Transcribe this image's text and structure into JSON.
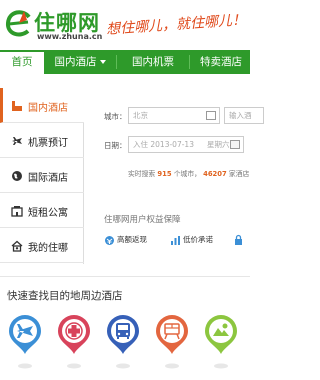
{
  "brand": {
    "logo_name": "住哪网",
    "logo_url": "www.zhuna.cn",
    "slogan": "想住哪儿，就住哪儿！",
    "color": "#2e9a2a"
  },
  "nav": {
    "items": [
      {
        "label": "首页"
      },
      {
        "label": "国内酒店"
      },
      {
        "label": "国内机票"
      },
      {
        "label": "特卖酒店"
      }
    ]
  },
  "sidebar": {
    "items": [
      {
        "label": "国内酒店",
        "icon": "hotel-icon"
      },
      {
        "label": "机票预订",
        "icon": "airplane-icon"
      },
      {
        "label": "国际酒店",
        "icon": "globe-icon"
      },
      {
        "label": "短租公寓",
        "icon": "apartment-icon"
      },
      {
        "label": "我的住哪",
        "icon": "home-icon"
      }
    ]
  },
  "search": {
    "city_label": "城市：",
    "city_value": "北京",
    "keyword_placeholder": "输入酒",
    "date_label": "日期：",
    "checkin_value": "入住  2013-07-13",
    "weekday": "星期六",
    "stats_prefix": "实时搜索",
    "city_count": "915",
    "city_unit": "个城市，",
    "hotel_count": "46207",
    "hotel_unit": "家酒店"
  },
  "guarantee": {
    "title": "住哪网用户权益保障",
    "badges": [
      {
        "label": "高额返现",
        "icon": "cashback-icon"
      },
      {
        "label": "低价承诺",
        "icon": "chart-icon"
      },
      {
        "label": "",
        "icon": "lock-icon"
      }
    ]
  },
  "nearby": {
    "title": "快速查找目的地周边酒店",
    "pins": [
      {
        "name": "airport",
        "icon": "airplane-icon",
        "color": "#3b8fd6"
      },
      {
        "name": "hospital",
        "icon": "medical-cross-icon",
        "color": "#d8435b"
      },
      {
        "name": "bus-station",
        "icon": "bus-icon",
        "color": "#3660b8"
      },
      {
        "name": "railway-station",
        "icon": "train-icon",
        "color": "#e3663f"
      },
      {
        "name": "attraction",
        "icon": "scenic-icon",
        "color": "#8cc63f"
      }
    ]
  }
}
